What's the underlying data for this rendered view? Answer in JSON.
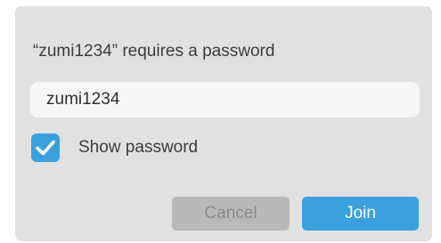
{
  "dialog": {
    "prompt": "“zumi1234” requires a password",
    "password_value": "zumi1234",
    "show_password_label": "Show password",
    "show_password_checked": true,
    "cancel_label": "Cancel",
    "join_label": "Join"
  },
  "colors": {
    "dialog_bg": "#e1e1e1",
    "field_bg": "#f7f7f7",
    "accent": "#3aa0de",
    "cancel_bg": "#b9b9b9",
    "cancel_text": "#8a8a8a"
  },
  "icons": {
    "checkbox": "checkmark-icon"
  }
}
